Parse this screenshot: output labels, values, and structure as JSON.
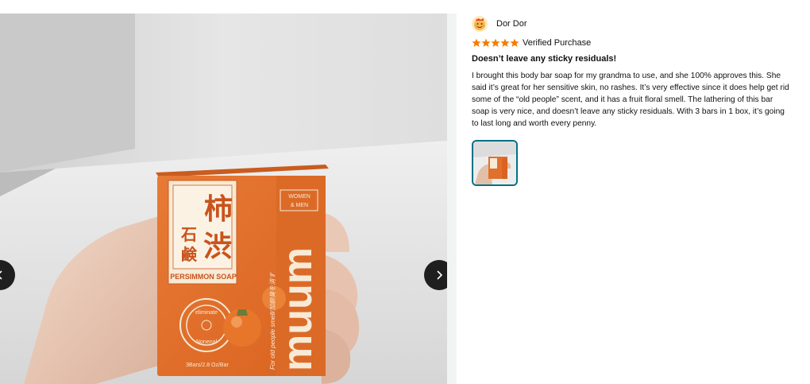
{
  "review": {
    "reviewer_name": "Dor Dor",
    "rating": 5,
    "rating_max": 5,
    "verified_label": "Verified Purchase",
    "title": "Doesn’t leave any sticky residuals!",
    "body": "I brought this body bar soap for my grandma to use, and she 100% approves this. She said it’s great for her sensitive skin, no rashes. It’s very effective since it does help get rid some of the “old people” scent, and it has a fruit floral smell. The lathering of this bar soap is very nice, and doesn’t leave any sticky residuals. With 3 bars in 1 box, it’s going to last long and worth every penny.",
    "thumbnail_count": 1
  },
  "product_box": {
    "kanji_top": "柿",
    "kanji_mid1": "石",
    "kanji_mid2": "渋",
    "kanji_bottom": "鹸",
    "label": "PERSIMMON SOAP",
    "badge_line1": "WOMEN",
    "badge_line2": "& MEN",
    "brand": "muum",
    "side_text": "For old people smell/加齢臭を消す",
    "seal_top": "eliminate",
    "seal_bottom": "Nonenal",
    "weight": "3Bars/2.8 Oz/Bar"
  },
  "icons": {
    "prev": "chevron-left-icon",
    "next": "chevron-right-icon",
    "star": "star-icon"
  },
  "colors": {
    "star": "#f57c00",
    "thumb_border": "#007185",
    "box_orange": "#e0702c"
  }
}
